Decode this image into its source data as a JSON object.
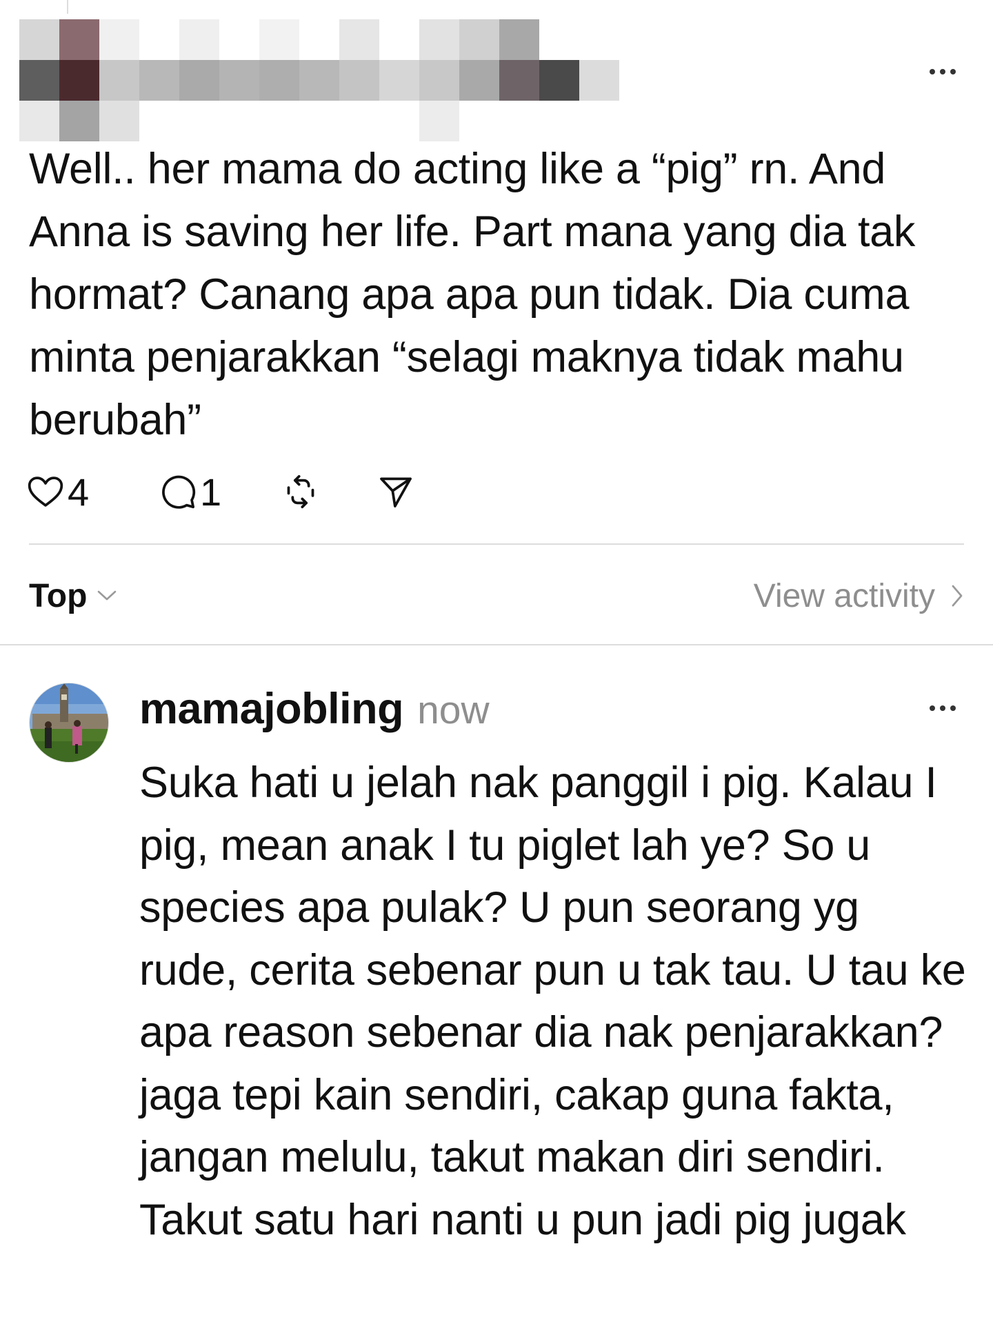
{
  "colors": {
    "text": "#111111",
    "secondary_text": "#8e8e8e",
    "divider": "#dcdcdc",
    "background": "#ffffff"
  },
  "post": {
    "author_name": "",
    "author_name_redacted": true,
    "more_icon": "more-horizontal-icon",
    "text": "Well.. her mama do acting like a “pig” rn. And Anna is saving her life. Part mana yang dia tak hormat? Canang apa apa pun tidak. Dia cuma minta penjarakkan “selagi maknya tidak mahu berubah”",
    "actions": {
      "like_icon": "heart-icon",
      "like_count": "4",
      "comment_icon": "comment-icon",
      "comment_count": "1",
      "repost_icon": "repost-icon",
      "share_icon": "send-icon"
    }
  },
  "sort_bar": {
    "sort_label": "Top",
    "sort_icon": "chevron-down-icon",
    "activity_label": "View activity",
    "activity_icon": "chevron-right-icon"
  },
  "reply": {
    "username": "mamajobling",
    "timestamp": "now",
    "more_icon": "more-horizontal-icon",
    "text": "Suka hati u jelah nak panggil i pig. Kalau I pig, mean anak I tu piglet lah ye? So u species apa pulak? U pun seorang yg rude, cerita sebenar pun u tak tau. U tau ke apa reason sebenar dia nak penjarakkan? jaga tepi kain sendiri, cakap guna fakta, jangan melulu, takut makan diri sendiri. Takut satu hari nanti u pun jadi pig jugak"
  }
}
